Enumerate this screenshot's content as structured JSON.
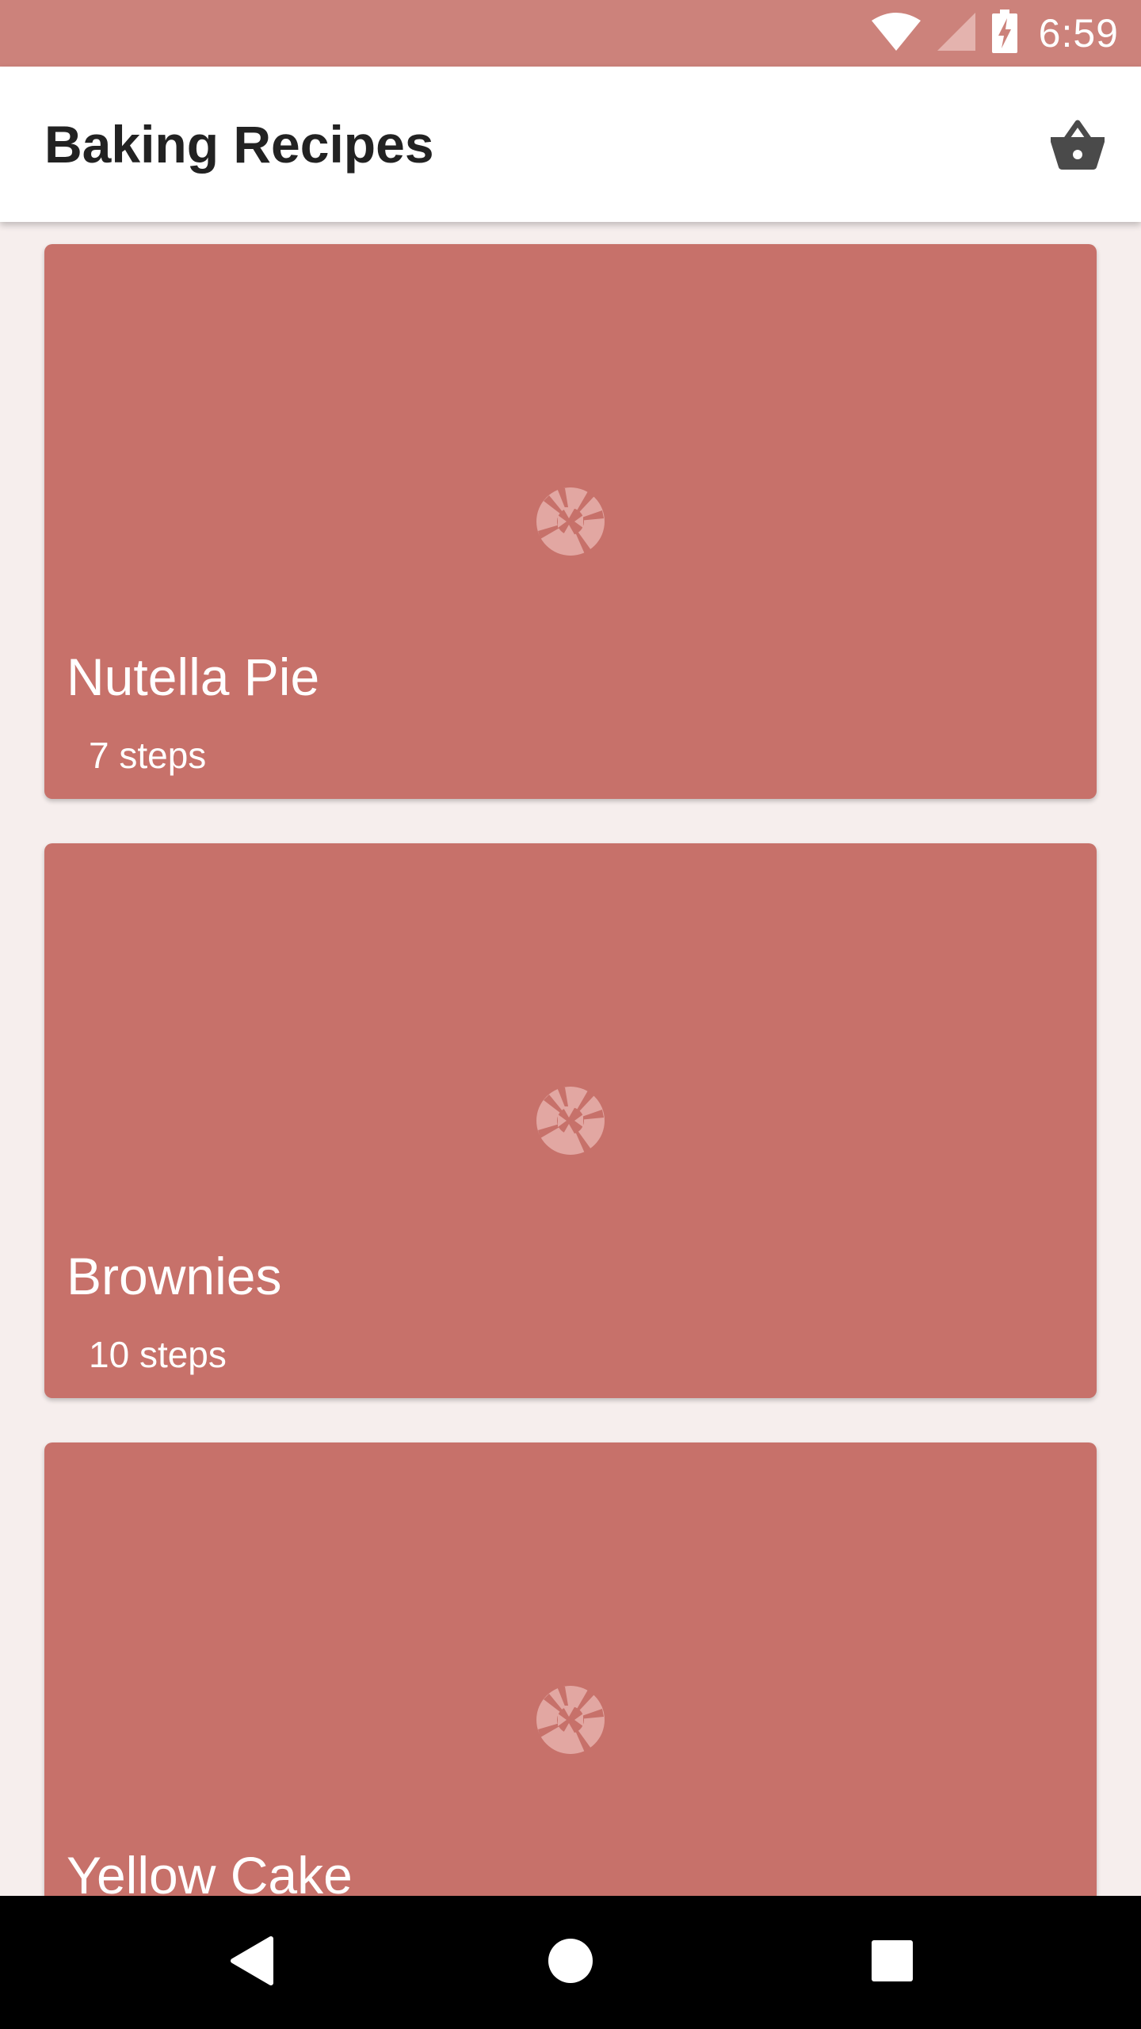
{
  "status_bar": {
    "time": "6:59",
    "icons": [
      "wifi-icon",
      "cellular-signal-icon",
      "battery-charging-icon"
    ]
  },
  "app_bar": {
    "title": "Baking Recipes",
    "action_icon": "basket-icon"
  },
  "colors": {
    "status_bar": "#CC827B",
    "app_bar": "#FFFFFF",
    "background": "#F6EEED",
    "card": "#C7716A",
    "card_text": "#FFFFFF",
    "image_placeholder_icon": "#E2A7A2",
    "nav_bar": "#000000"
  },
  "recipes": [
    {
      "name": "Nutella Pie",
      "steps": "7 steps",
      "image_icon": "camera-aperture-icon"
    },
    {
      "name": "Brownies",
      "steps": "10 steps",
      "image_icon": "camera-aperture-icon"
    },
    {
      "name": "Yellow Cake",
      "steps": "",
      "image_icon": "camera-aperture-icon"
    }
  ],
  "nav_bar": {
    "buttons": [
      "back-icon",
      "home-icon",
      "recents-icon"
    ]
  }
}
